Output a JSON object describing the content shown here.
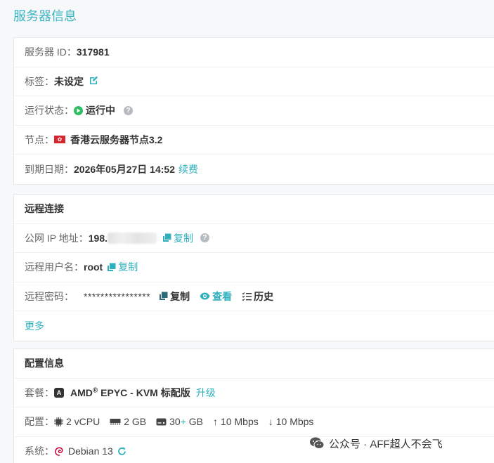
{
  "page_title": "服务器信息",
  "info": {
    "server_id_label": "服务器 ID：",
    "server_id": "317981",
    "tag_label": "标签：",
    "tag_value": "未设定",
    "status_label": "运行状态：",
    "status_value": "运行中",
    "node_label": "节点：",
    "node_value": "香港云服务器节点3.2",
    "expire_label": "到期日期：",
    "expire_value": "2026年05月27日 14:52",
    "renew_label": "续费"
  },
  "remote": {
    "title": "远程连接",
    "ip_label": "公网 IP 地址：",
    "ip_value": "198.",
    "copy_label": "复制",
    "user_label": "远程用户名：",
    "user_value": "root",
    "pwd_label": "远程密码：",
    "pwd_value": "****************",
    "view_label": "查看",
    "history_label": "历史",
    "more_label": "更多"
  },
  "config": {
    "title": "配置信息",
    "plan_label": "套餐：",
    "plan_badge": "A",
    "plan_value_pre": "AMD",
    "plan_reg": "®",
    "plan_value_post": " EPYC - KVM 标配版",
    "upgrade_label": "升级",
    "config_label": "配置：",
    "cpu": "2 vCPU",
    "ram": "2 GB",
    "disk_pre": "30",
    "disk_plus": "+",
    "disk_post": " GB",
    "up": "10 Mbps",
    "down": "10 Mbps",
    "os_label": "系统：",
    "os_value": "Debian 13"
  },
  "watermark": "公众号 · AFF超人不会飞",
  "colors": {
    "accent": "#2fb0be",
    "title": "#3bb4c2",
    "running": "#2dbe61"
  }
}
